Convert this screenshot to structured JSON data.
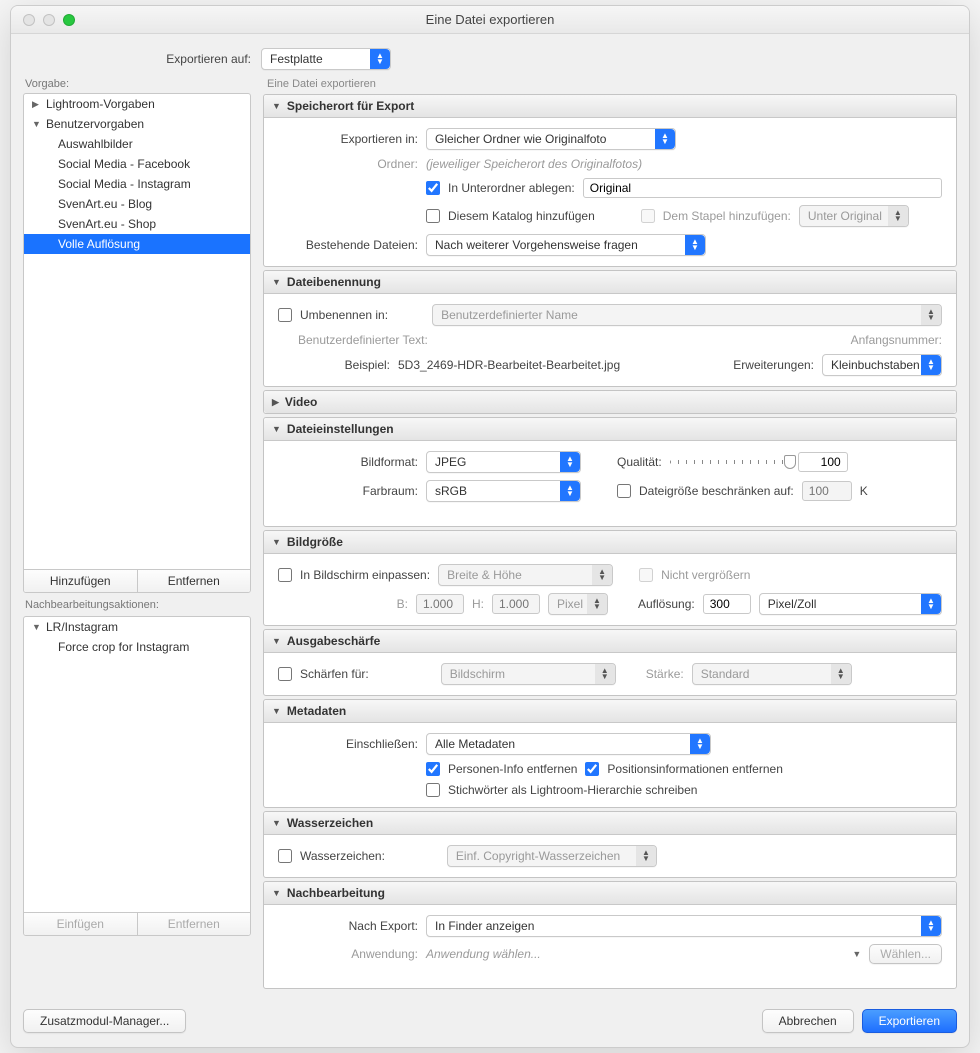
{
  "window": {
    "title": "Eine Datei exportieren"
  },
  "top": {
    "export_to_label": "Exportieren auf:",
    "export_to_value": "Festplatte"
  },
  "sidebar": {
    "preset_label": "Vorgabe:",
    "groups": [
      {
        "label": "Lightroom-Vorgaben",
        "expanded": false
      },
      {
        "label": "Benutzervorgaben",
        "expanded": true
      }
    ],
    "user_items": [
      "Auswahlbilder",
      "Social Media - Facebook",
      "Social Media - Instagram",
      "SvenArt.eu - Blog",
      "SvenArt.eu - Shop",
      "Volle Auflösung"
    ],
    "selected_index": 5,
    "add_btn": "Hinzufügen",
    "remove_btn": "Entfernen",
    "post_actions_label": "Nachbearbeitungsaktionen:",
    "post_group": "LR/Instagram",
    "post_item": "Force crop for Instagram",
    "insert_btn": "Einfügen",
    "remove2_btn": "Entfernen"
  },
  "main_subheader": "Eine Datei exportieren",
  "sections": {
    "export_location": {
      "title": "Speicherort für Export",
      "export_in_label": "Exportieren in:",
      "export_in_value": "Gleicher Ordner wie Originalfoto",
      "folder_label": "Ordner:",
      "folder_hint": "(jeweiliger Speicherort des Originalfotos)",
      "subfolder_label": "In Unterordner ablegen:",
      "subfolder_value": "Original",
      "add_catalog_label": "Diesem Katalog hinzufügen",
      "add_stack_label": "Dem Stapel hinzufügen:",
      "stack_pos_value": "Unter Original",
      "existing_label": "Bestehende Dateien:",
      "existing_value": "Nach weiterer Vorgehensweise fragen"
    },
    "naming": {
      "title": "Dateibenennung",
      "rename_label": "Umbenennen in:",
      "rename_placeholder": "Benutzerdefinierter Name",
      "custom_text_label": "Benutzerdefinierter Text:",
      "start_num_label": "Anfangsnummer:",
      "example_label": "Beispiel:",
      "example_value": "5D3_2469-HDR-Bearbeitet-Bearbeitet.jpg",
      "extensions_label": "Erweiterungen:",
      "extensions_value": "Kleinbuchstaben"
    },
    "video": {
      "title": "Video"
    },
    "file_settings": {
      "title": "Dateieinstellungen",
      "format_label": "Bildformat:",
      "format_value": "JPEG",
      "quality_label": "Qualität:",
      "quality_value": "100",
      "colorspace_label": "Farbraum:",
      "colorspace_value": "sRGB",
      "limit_size_label": "Dateigröße beschränken auf:",
      "limit_size_placeholder": "100",
      "limit_size_unit": "K"
    },
    "image_sizing": {
      "title": "Bildgröße",
      "fit_label": "In Bildschirm einpassen:",
      "fit_value": "Breite & Höhe",
      "no_enlarge_label": "Nicht vergrößern",
      "w_label": "B:",
      "w_value": "1.000",
      "h_label": "H:",
      "h_value": "1.000",
      "unit_value": "Pixel",
      "resolution_label": "Auflösung:",
      "resolution_value": "300",
      "resolution_unit": "Pixel/Zoll"
    },
    "sharpen": {
      "title": "Ausgabeschärfe",
      "sharpen_label": "Schärfen für:",
      "sharpen_value": "Bildschirm",
      "amount_label": "Stärke:",
      "amount_value": "Standard"
    },
    "metadata": {
      "title": "Metadaten",
      "include_label": "Einschließen:",
      "include_value": "Alle Metadaten",
      "remove_person_label": "Personen-Info entfernen",
      "remove_location_label": "Positionsinformationen entfernen",
      "keyword_hierarchy_label": "Stichwörter als Lightroom-Hierarchie schreiben"
    },
    "watermark": {
      "title": "Wasserzeichen",
      "label": "Wasserzeichen:",
      "value": "Einf. Copyright-Wasserzeichen"
    },
    "post": {
      "title": "Nachbearbeitung",
      "after_export_label": "Nach Export:",
      "after_export_value": "In Finder anzeigen",
      "app_label": "Anwendung:",
      "app_placeholder": "Anwendung wählen...",
      "choose_btn": "Wählen..."
    }
  },
  "footer": {
    "plugin_manager": "Zusatzmodul-Manager...",
    "cancel": "Abbrechen",
    "export": "Exportieren"
  }
}
